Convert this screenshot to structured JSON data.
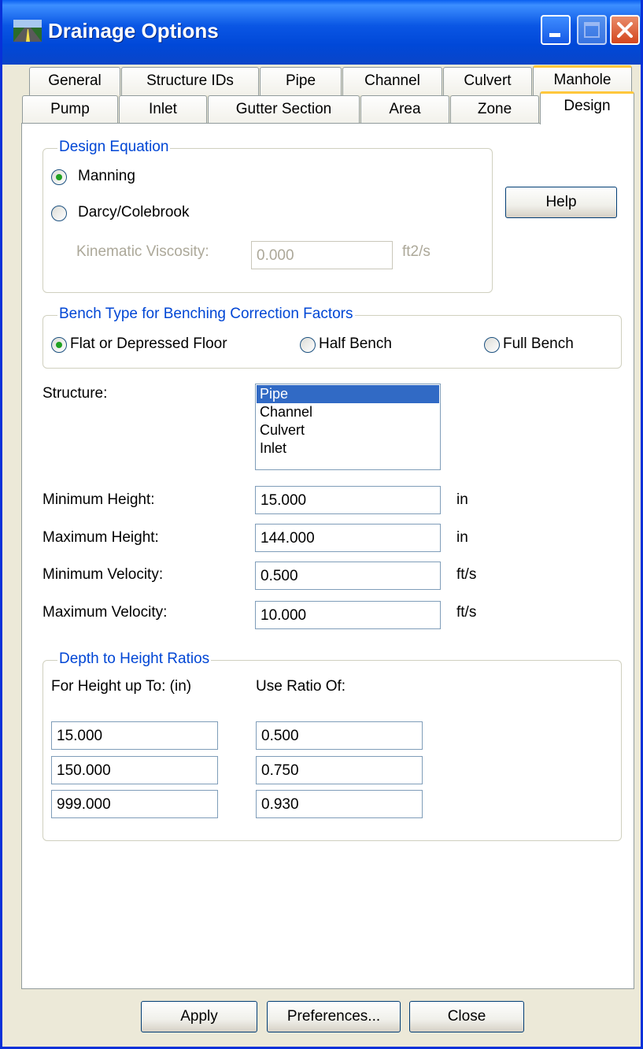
{
  "window": {
    "title": "Drainage Options"
  },
  "tabs_row1": [
    "General",
    "Structure IDs",
    "Pipe",
    "Channel",
    "Culvert",
    "Manhole"
  ],
  "tabs_row2": [
    "Pump",
    "Inlet",
    "Gutter Section",
    "Area",
    "Zone",
    "Design"
  ],
  "design_equation": {
    "legend": "Design Equation",
    "manning_label": "Manning",
    "darcy_label": "Darcy/Colebrook",
    "selected": "Manning",
    "viscosity_label": "Kinematic Viscosity:",
    "viscosity_value": "0.000",
    "viscosity_unit": "ft2/s"
  },
  "help_label": "Help",
  "bench": {
    "legend": "Bench Type for Benching Correction Factors",
    "flat_label": "Flat or Depressed Floor",
    "half_label": "Half Bench",
    "full_label": "Full Bench",
    "selected": "Flat or Depressed Floor"
  },
  "structure": {
    "label": "Structure:",
    "items": [
      "Pipe",
      "Channel",
      "Culvert",
      "Inlet"
    ],
    "selected": "Pipe"
  },
  "limits": [
    {
      "label": "Minimum Height:",
      "value": "15.000",
      "unit": "in"
    },
    {
      "label": "Maximum Height:",
      "value": "144.000",
      "unit": "in"
    },
    {
      "label": "Minimum Velocity:",
      "value": "0.500",
      "unit": "ft/s"
    },
    {
      "label": "Maximum Velocity:",
      "value": "10.000",
      "unit": "ft/s"
    }
  ],
  "ratios": {
    "legend": "Depth to Height Ratios",
    "col1_header": "For Height up To: (in)",
    "col2_header": "Use Ratio Of:",
    "rows": [
      {
        "height": "15.000",
        "ratio": "0.500"
      },
      {
        "height": "150.000",
        "ratio": "0.750"
      },
      {
        "height": "999.000",
        "ratio": "0.930"
      }
    ]
  },
  "footer": {
    "apply": "Apply",
    "preferences": "Preferences...",
    "close": "Close"
  },
  "colors": {
    "title_bar": "#0a56e4",
    "group_legend": "#0046d5",
    "selection": "#316ac5",
    "radio_dot": "#21a121",
    "tab_highlight": "#ffc73c"
  }
}
